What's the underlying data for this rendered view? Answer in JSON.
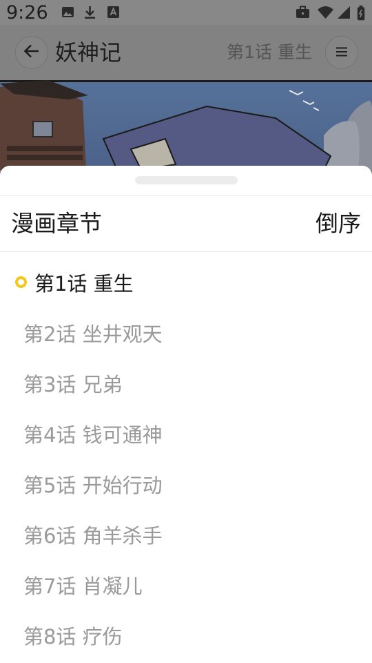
{
  "status_bar": {
    "time": "9:26",
    "left_icons": [
      "image-icon",
      "download-icon",
      "text-icon"
    ],
    "right_icons": [
      "briefcase-icon",
      "wifi-icon",
      "signal-icon",
      "battery-icon"
    ]
  },
  "header": {
    "title": "妖神记",
    "current_chapter": "第1话 重生",
    "back_icon": "arrow-left-icon",
    "menu_icon": "menu-icon"
  },
  "sheet": {
    "title": "漫画章节",
    "sort_label": "倒序",
    "chapters": [
      {
        "label": "第1话 重生",
        "active": true
      },
      {
        "label": "第2话 坐井观天",
        "active": false
      },
      {
        "label": "第3话 兄弟",
        "active": false
      },
      {
        "label": "第4话 钱可通神",
        "active": false
      },
      {
        "label": "第5话 开始行动",
        "active": false
      },
      {
        "label": "第6话 角羊杀手",
        "active": false
      },
      {
        "label": "第7话 肖凝儿",
        "active": false
      },
      {
        "label": "第8话 疗伤",
        "active": false
      }
    ]
  },
  "colors": {
    "accent": "#f6c716",
    "active_text": "#1a1a1a",
    "inactive_text": "#9a9a9a",
    "overlay": "#808080"
  }
}
